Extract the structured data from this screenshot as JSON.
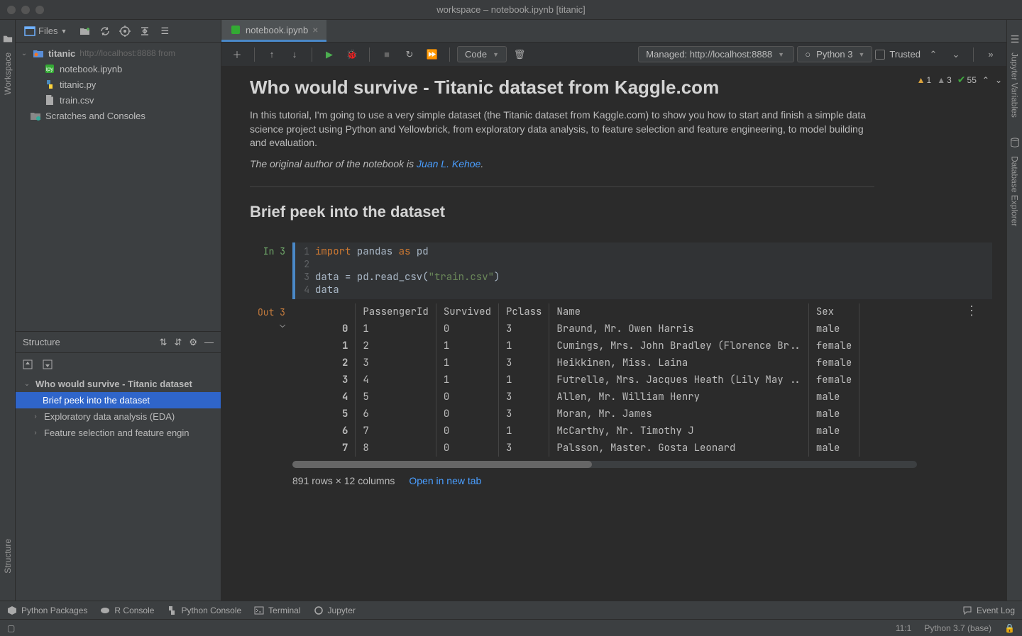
{
  "window": {
    "title": "workspace – notebook.ipynb [titanic]"
  },
  "left_rail": {
    "workspace": "Workspace",
    "structure": "Structure"
  },
  "right_rail": {
    "jupyter": "Jupyter Variables",
    "database": "Database Explorer"
  },
  "project_toolbar": {
    "files_label": "Files"
  },
  "project_tree": {
    "root": {
      "label": "titanic",
      "hint": "http://localhost:8888 from"
    },
    "files": [
      {
        "label": "notebook.ipynb",
        "icon": "jupyter"
      },
      {
        "label": "titanic.py",
        "icon": "python"
      },
      {
        "label": "train.csv",
        "icon": "file"
      }
    ],
    "scratches": "Scratches and Consoles"
  },
  "structure_panel": {
    "title": "Structure",
    "root": "Who would survive - Titanic dataset",
    "items": [
      {
        "label": "Brief peek into the dataset",
        "selected": true
      },
      {
        "label": "Exploratory data analysis (EDA)",
        "expandable": true
      },
      {
        "label": "Feature selection and feature engin",
        "expandable": true
      }
    ]
  },
  "editor": {
    "tab": "notebook.ipynb"
  },
  "notebook_toolbar": {
    "cell_type": "Code",
    "server": "Managed: http://localhost:8888",
    "kernel": "Python 3",
    "trusted": "Trusted"
  },
  "inspection": {
    "warn1_count": "1",
    "warn2_count": "3",
    "ok_count": "55"
  },
  "notebook": {
    "h1": "Who would survive - Titanic dataset from Kaggle.com",
    "p1": "In this tutorial, I'm going to use a very simple dataset (the Titanic dataset from Kaggle.com) to show you how to start and finish a simple data science project using Python and Yellowbrick, from exploratory data analysis, to feature selection and feature engineering, to model building and evaluation.",
    "p2_prefix": "The original author of the notebook is ",
    "p2_link": "Juan L. Kehoe",
    "p2_suffix": ".",
    "h2": "Brief peek into the dataset",
    "in_label": "In 3",
    "out_label": "Out 3",
    "code": {
      "l1_kw1": "import",
      "l1_id1": " pandas ",
      "l1_kw2": "as",
      "l1_id2": " pd",
      "l3_a": "data = pd.read_csv(",
      "l3_str": "\"train.csv\"",
      "l3_b": ")",
      "l4": "data"
    },
    "df": {
      "columns": [
        "",
        "PassengerId",
        "Survived",
        "Pclass",
        "Name",
        "Sex"
      ],
      "rows": [
        [
          "0",
          "1",
          "0",
          "3",
          "Braund, Mr. Owen Harris",
          "male"
        ],
        [
          "1",
          "2",
          "1",
          "1",
          "Cumings, Mrs. John Bradley (Florence Br..",
          "female"
        ],
        [
          "2",
          "3",
          "1",
          "3",
          "Heikkinen, Miss. Laina",
          "female"
        ],
        [
          "3",
          "4",
          "1",
          "1",
          "Futrelle, Mrs. Jacques Heath (Lily May ..",
          "female"
        ],
        [
          "4",
          "5",
          "0",
          "3",
          "Allen, Mr. William Henry",
          "male"
        ],
        [
          "5",
          "6",
          "0",
          "3",
          "Moran, Mr. James",
          "male"
        ],
        [
          "6",
          "7",
          "0",
          "1",
          "McCarthy, Mr. Timothy J",
          "male"
        ],
        [
          "7",
          "8",
          "0",
          "3",
          "Palsson, Master. Gosta Leonard",
          "male"
        ]
      ],
      "shape": "891 rows × 12 columns",
      "open_link": "Open in new tab"
    }
  },
  "bottom_bar": {
    "python_packages": "Python Packages",
    "r_console": "R Console",
    "python_console": "Python Console",
    "terminal": "Terminal",
    "jupyter": "Jupyter",
    "event_log": "Event Log"
  },
  "status_bar": {
    "cursor": "11:1",
    "interpreter": "Python 3.7 (base)"
  }
}
